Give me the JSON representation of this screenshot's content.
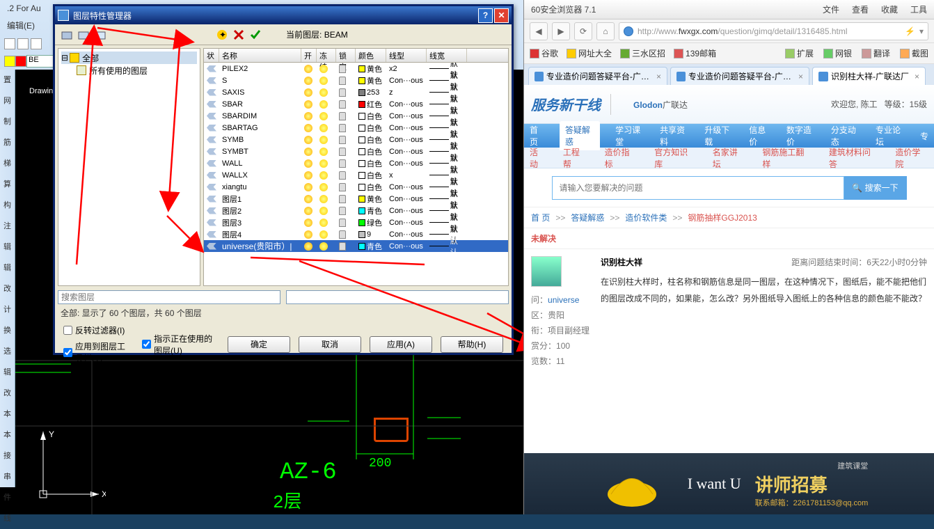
{
  "cad": {
    "app_title": ".2 For Au",
    "menu": [
      "编辑(E)"
    ],
    "layer_sel": "BE",
    "side_tabs": [
      "置",
      "网",
      "制",
      "筋",
      "梯",
      "算",
      "构",
      "注",
      "辑",
      "辑",
      "改",
      "计",
      "换",
      "选",
      "辑",
      "改",
      "本",
      "本",
      "接",
      "串",
      "件",
      "线"
    ],
    "drawing_label": "Drawin",
    "dim_200": "200",
    "label_az6": "AZ-6",
    "label_2c": "2层"
  },
  "dlg": {
    "title": "图层特性管理器",
    "current_label": "当前图层:",
    "current_value": "BEAM",
    "tree_root": "全部",
    "tree_child": "所有使用的图层",
    "cols": {
      "stat": "状",
      "name": "名称",
      "on": "开",
      "freeze": "冻结",
      "lock": "锁定",
      "color": "颜色",
      "ltype": "线型",
      "lwt": "线宽"
    },
    "rows": [
      {
        "name": "PILEX2",
        "color": "黄色",
        "swatch": "#ffff00",
        "ltype": "x2",
        "lwt": "默认"
      },
      {
        "name": "S",
        "color": "黄色",
        "swatch": "#ffff00",
        "ltype": "Con···ous",
        "lwt": "默认"
      },
      {
        "name": "SAXIS",
        "color": "253",
        "swatch": "#808080",
        "ltype": "z",
        "lwt": "默认"
      },
      {
        "name": "SBAR",
        "color": "红色",
        "swatch": "#ff0000",
        "ltype": "Con···ous",
        "lwt": "默认"
      },
      {
        "name": "SBARDIM",
        "color": "白色",
        "swatch": "#ffffff",
        "ltype": "Con···ous",
        "lwt": "默认"
      },
      {
        "name": "SBARTAG",
        "color": "白色",
        "swatch": "#ffffff",
        "ltype": "Con···ous",
        "lwt": "默认"
      },
      {
        "name": "SYMB",
        "color": "白色",
        "swatch": "#ffffff",
        "ltype": "Con···ous",
        "lwt": "默认"
      },
      {
        "name": "SYMBT",
        "color": "白色",
        "swatch": "#ffffff",
        "ltype": "Con···ous",
        "lwt": "默认"
      },
      {
        "name": "WALL",
        "color": "白色",
        "swatch": "#ffffff",
        "ltype": "Con···ous",
        "lwt": "默认"
      },
      {
        "name": "WALLX",
        "color": "白色",
        "swatch": "#ffffff",
        "ltype": "x",
        "lwt": "默认"
      },
      {
        "name": "xiangtu",
        "color": "白色",
        "swatch": "#ffffff",
        "ltype": "Con···ous",
        "lwt": "默认"
      },
      {
        "name": "图层1",
        "color": "黄色",
        "swatch": "#ffff00",
        "ltype": "Con···ous",
        "lwt": "默认"
      },
      {
        "name": "图层2",
        "color": "青色",
        "swatch": "#00ffff",
        "ltype": "Con···ous",
        "lwt": "默认"
      },
      {
        "name": "图层3",
        "color": "绿色",
        "swatch": "#00ff00",
        "ltype": "Con···ous",
        "lwt": "默认"
      },
      {
        "name": "图层4",
        "color": "9",
        "swatch": "#c0c0c0",
        "ltype": "Con···ous",
        "lwt": "默认"
      },
      {
        "name": "universe(贵阳市）|",
        "color": "青色",
        "swatch": "#00ffff",
        "ltype": "Con···ous",
        "lwt": "默认",
        "sel": true
      }
    ],
    "search_ph": "搜索图层",
    "summary": "全部: 显示了 60 个图层，共 60 个图层",
    "chk_invert": "反转过滤器(I)",
    "chk_inuse": "指示正在使用的图层(U)",
    "chk_apply": "应用到图层工具栏(T)",
    "btn_ok": "确定",
    "btn_cancel": "取消",
    "btn_apply": "应用(A)",
    "btn_help": "帮助(H)"
  },
  "browser": {
    "title": "60安全浏览器 7.1",
    "title_menu": [
      "文件",
      "查看",
      "收藏",
      "工具"
    ],
    "url_prefix": "http://www.",
    "url_host": "fwxgx.com",
    "url_path": "/question/gimq/detail/1316485.html",
    "bookmarks_left": [
      "谷歌",
      "网址大全",
      "三水区招",
      "139邮箱"
    ],
    "bookmarks_right": [
      "扩展",
      "网银",
      "翻译",
      "截图"
    ],
    "tabs": [
      {
        "label": "专业造价问题答疑平台-广联达!",
        "active": false
      },
      {
        "label": "专业造价问题答疑平台-广联达!",
        "active": false
      },
      {
        "label": "识别柱大祥-广联达厂",
        "active": true
      }
    ],
    "logo1": "服务新干线",
    "logo2a": "Glodon",
    "logo2b": "广联达",
    "welcome_prefix": "欢迎您, ",
    "welcome_user": "陈工",
    "welcome_level": "等级：15级",
    "nav1": [
      "首页",
      "答疑解惑",
      "学习课堂",
      "共享资料",
      "升级下载",
      "信息价",
      "数字造价",
      "分支动态",
      "专业论坛",
      "专"
    ],
    "nav1_active_index": 1,
    "nav2": [
      {
        "t": "活动",
        "c": "red"
      },
      {
        "t": "工程帮",
        "c": "red"
      },
      {
        "t": "造价指标",
        "c": "red"
      },
      {
        "t": "官方知识库",
        "c": "red"
      },
      {
        "t": "名家讲坛",
        "c": "red"
      },
      {
        "t": "钢筋施工翻样",
        "c": "red"
      },
      {
        "t": "建筑材料问答",
        "c": "red"
      },
      {
        "t": "造价学院",
        "c": "red"
      }
    ],
    "search_ph": "请输入您要解决的问题",
    "search_btn": "🔍  搜索一下",
    "crumb": [
      "首 页",
      "答疑解惑",
      "造价软件类",
      "钢筋抽样GGJ2013"
    ],
    "status": "未解决",
    "q_title": "识别柱大祥",
    "q_time_label": "距离问题结束时间：",
    "q_time_value": "6天22小时0分钟",
    "q_text": "在识别柱大样时，柱名称和钢筋信息是同一图层，在这种情况下，图纸后，能不能把他们的图层改成不同的，如果能，怎么改？另外图纸导入图纸上的各种信息的颜色能不能改？",
    "meta_labels": {
      "asker": "问：",
      "region": "区：",
      "role": "衔：",
      "reward": "赏分：",
      "views": "览数："
    },
    "meta": {
      "asker": "universe",
      "region": "贵阳",
      "role": "项目副经理",
      "reward": "100",
      "views": "11"
    },
    "banner_pretitle": "建筑课堂",
    "banner_title": "讲师招募",
    "banner_email": "联系邮箱：2261781153@qq.com",
    "scribble": "I  want  U"
  }
}
